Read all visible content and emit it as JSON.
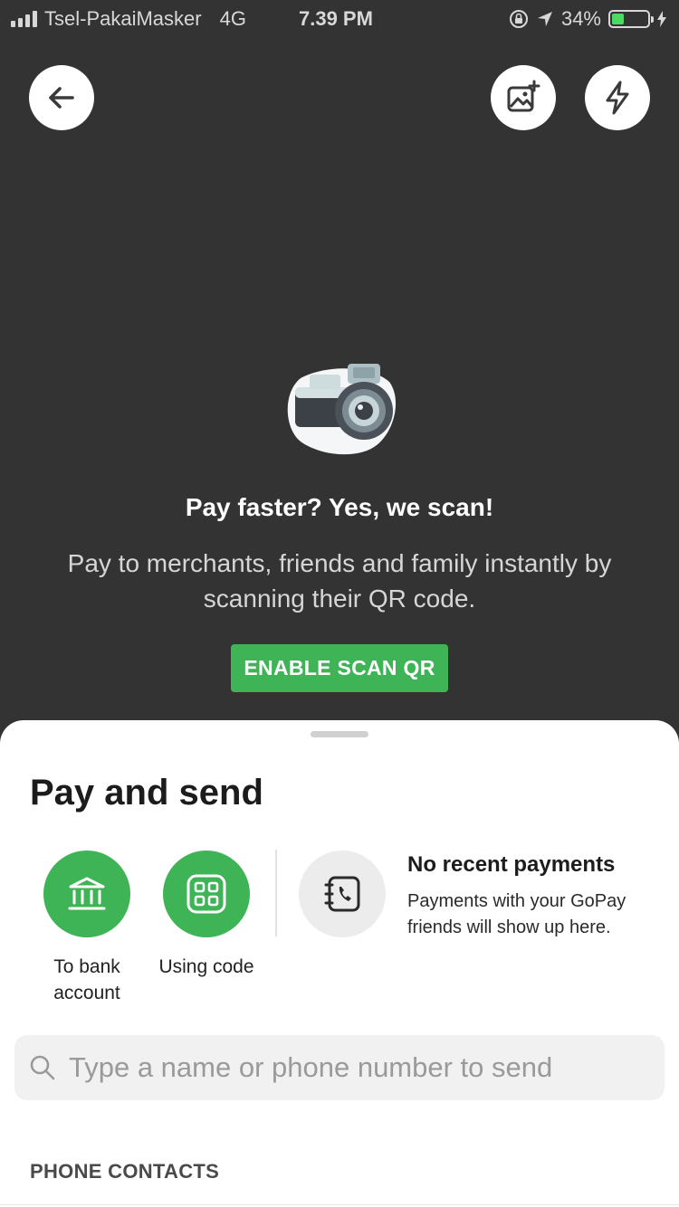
{
  "status_bar": {
    "carrier": "Tsel-PakaiMasker",
    "network": "4G",
    "time": "7.39 PM",
    "battery_percent": "34%",
    "battery_level": 0.34
  },
  "scan": {
    "title": "Pay faster? Yes, we scan!",
    "description": "Pay to merchants, friends and family instantly by scanning their QR code.",
    "enable_button": "ENABLE SCAN QR"
  },
  "sheet": {
    "title": "Pay and send",
    "actions": [
      {
        "label": "To bank account",
        "icon": "bank-icon"
      },
      {
        "label": "Using code",
        "icon": "code-grid-icon"
      }
    ],
    "recent": {
      "title": "No recent payments",
      "description": "Payments with your GoPay friends will show up here."
    },
    "search": {
      "placeholder": "Type a name or phone number to send"
    },
    "section_label": "PHONE CONTACTS"
  },
  "colors": {
    "background": "#333333",
    "accent_green": "#3fb456",
    "sheet": "#ffffff"
  }
}
